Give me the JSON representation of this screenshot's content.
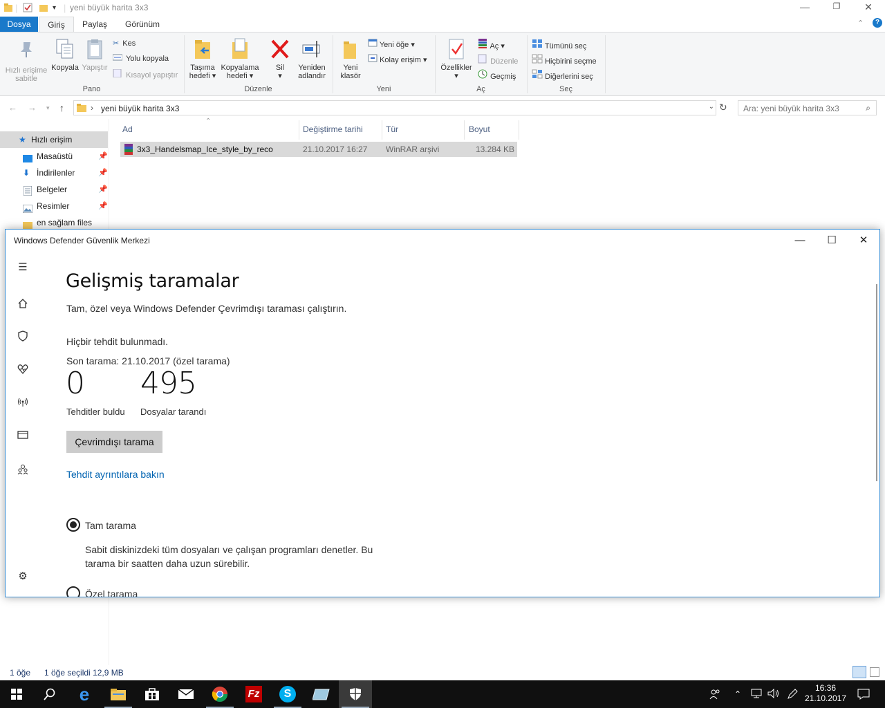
{
  "explorer": {
    "title": "yeni büyük harita 3x3",
    "tabs": [
      "Dosya",
      "Giriş",
      "Paylaş",
      "Görünüm"
    ],
    "ribbon": {
      "pano": {
        "label": "Pano",
        "pin_label_1": "Hızlı erişime",
        "pin_label_2": "sabitle",
        "copy_label": "Kopyala",
        "paste_label": "Yapıştır",
        "cut_label": "Kes",
        "copy_path_label": "Yolu kopyala",
        "paste_shortcut_label": "Kısayol yapıştır"
      },
      "duzenle": {
        "label": "Düzenle",
        "move_1": "Taşıma",
        "move_2": "hedefi",
        "copy_1": "Kopyalama",
        "copy_2": "hedefi",
        "delete_label": "Sil",
        "rename_1": "Yeniden",
        "rename_2": "adlandır"
      },
      "yeni": {
        "label": "Yeni",
        "folder_1": "Yeni",
        "folder_2": "klasör",
        "new_item": "Yeni öğe",
        "easy_access": "Kolay erişim"
      },
      "ac": {
        "label": "Aç",
        "properties": "Özellikler",
        "open": "Aç",
        "edit": "Düzenle",
        "history": "Geçmiş"
      },
      "sec": {
        "label": "Seç",
        "select_all": "Tümünü seç",
        "select_none": "Hiçbirini seçme",
        "invert": "Diğerlerini seç"
      }
    },
    "address": {
      "path": "yeni büyük harita 3x3",
      "search_placeholder": "Ara: yeni büyük harita 3x3"
    },
    "nav": [
      {
        "label": "Hızlı erişim"
      },
      {
        "label": "Masaüstü"
      },
      {
        "label": "İndirilenler"
      },
      {
        "label": "Belgeler"
      },
      {
        "label": "Resimler"
      },
      {
        "label": "en sağlam files"
      }
    ],
    "columns": [
      "Ad",
      "Değiştirme tarihi",
      "Tür",
      "Boyut"
    ],
    "files": [
      {
        "name": "3x3_Handelsmap_Ice_style_by_reco",
        "date": "21.10.2017 16:27",
        "type": "WinRAR arşivi",
        "size": "13.284 KB"
      }
    ],
    "status": {
      "count": "1 öğe",
      "selected": "1 öğe seçildi  12,9 MB"
    }
  },
  "defender": {
    "window_title": "Windows Defender Güvenlik Merkezi",
    "heading": "Gelişmiş taramalar",
    "subtitle": "Tam, özel veya Windows Defender Çevrimdışı taraması çalıştırın.",
    "no_threats": "Hiçbir tehdit bulunmadı.",
    "last_scan": "Son tarama: 21.10.2017 (özel tarama)",
    "threats_found": "0",
    "threats_found_label": "Tehditler buldu",
    "files_scanned": "495",
    "files_scanned_label": "Dosyalar tarandı",
    "offline_button": "Çevrimdışı tarama",
    "details_link": "Tehdit ayrıntılara bakın",
    "full_scan_label": "Tam tarama",
    "full_scan_desc_1": "Sabit diskinizdeki tüm dosyaları ve çalışan programları denetler. Bu",
    "full_scan_desc_2": "tarama bir saatten daha uzun sürebilir.",
    "custom_scan_label": "Özel tarama"
  },
  "taskbar": {
    "time": "16:36",
    "date": "21.10.2017"
  }
}
